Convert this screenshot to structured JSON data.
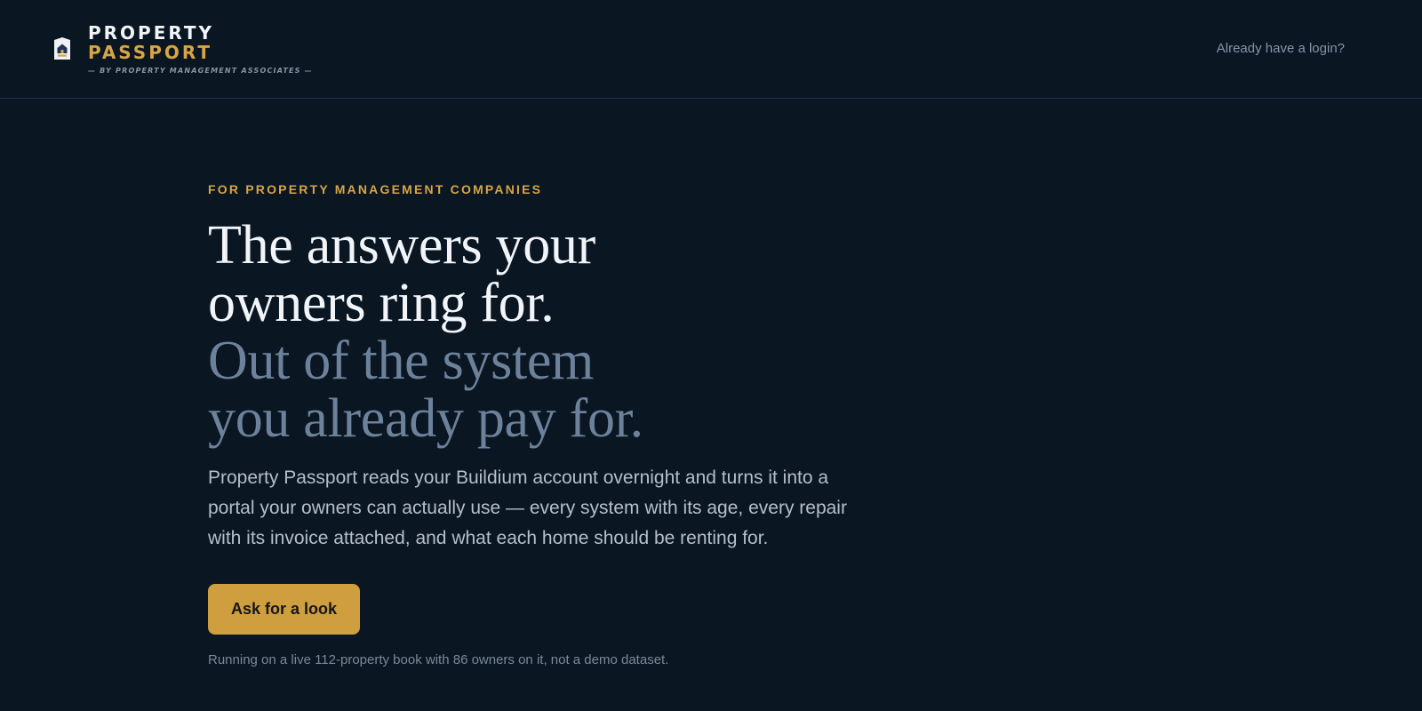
{
  "brand": {
    "line1": "PROPERTY",
    "line2": "PASSPORT",
    "tagline": "— BY PROPERTY MANAGEMENT ASSOCIATES —",
    "icon": "house-badge-icon"
  },
  "header": {
    "login_link": "Already have a login?"
  },
  "hero": {
    "eyebrow": "FOR PROPERTY MANAGEMENT COMPANIES",
    "headline": {
      "line1": "The answers your",
      "line2": "owners ring for.",
      "line3": "Out of the system",
      "line4": "you already pay for."
    },
    "lede": "Property Passport reads your Buildium account overnight and turns it into a portal your owners can actually use — every system with its age, every repair with its invoice attached, and what each home should be renting for.",
    "cta_label": "Ask for a look",
    "footnote": "Running on a live 112-property book with 86 owners on it, not a demo dataset."
  },
  "colors": {
    "background": "#0a1622",
    "accent": "#d7a545",
    "button": "#cf9e3e",
    "headline": "#f1f4f8",
    "headline_muted": "#6c819a",
    "body_text": "#b5bfcb",
    "muted_text": "#8794a6"
  }
}
